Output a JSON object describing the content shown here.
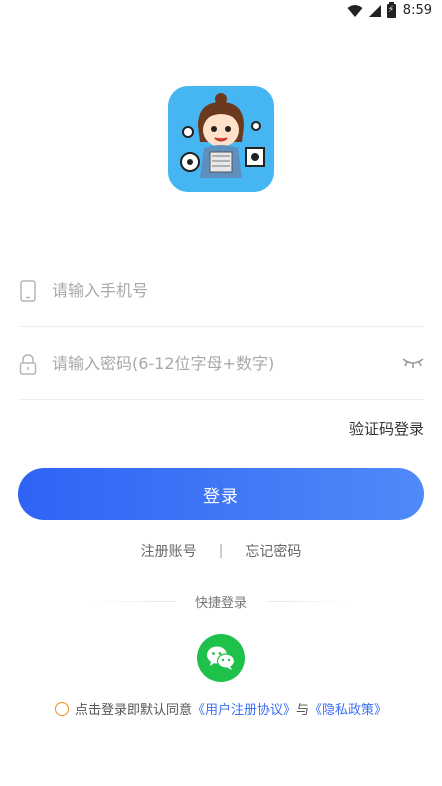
{
  "status": {
    "time": "8:59"
  },
  "form": {
    "phone_placeholder": "请输入手机号",
    "password_placeholder": "请输入密码(6-12位字母+数字)",
    "code_login": "验证码登录",
    "login_button": "登录"
  },
  "links": {
    "register": "注册账号",
    "separator": "|",
    "forgot": "忘记密码"
  },
  "quick_login": {
    "title": "快捷登录"
  },
  "agreement": {
    "prefix": "点击登录即默认同意",
    "user_agreement": "《用户注册协议》",
    "and": "与",
    "privacy": "《隐私政策》"
  },
  "colors": {
    "primary": "#2f63f5",
    "wechat": "#1ec24a",
    "radio": "#f28c1e",
    "logo_bg": "#45b6f2"
  },
  "icons": [
    "wifi-icon",
    "signal-icon",
    "battery-icon",
    "phone-icon",
    "lock-icon",
    "eye-closed-icon",
    "wechat-icon"
  ]
}
